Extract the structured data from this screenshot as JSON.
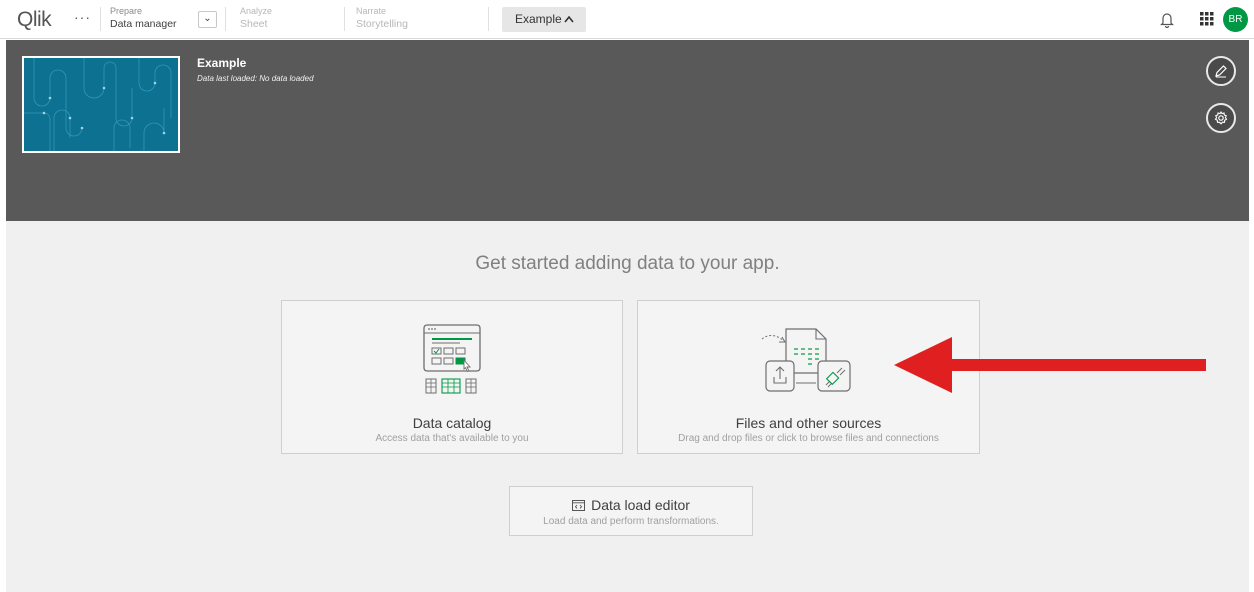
{
  "brand": {
    "logo": "Qlik",
    "more": "···"
  },
  "nav": {
    "prepare": {
      "label": "Prepare",
      "value": "Data manager"
    },
    "analyze": {
      "label": "Analyze",
      "value": "Sheet"
    },
    "narrate": {
      "label": "Narrate",
      "value": "Storytelling"
    },
    "app_tab": "Example"
  },
  "user": {
    "initials": "BR"
  },
  "app": {
    "title": "Example",
    "subtitle": "Data last loaded: No data loaded"
  },
  "main": {
    "headline": "Get started adding data to your app.",
    "cards": {
      "catalog": {
        "title": "Data catalog",
        "desc": "Access data that's available to you"
      },
      "files": {
        "title": "Files and other sources",
        "desc": "Drag and drop files or click to browse files and connections"
      },
      "editor": {
        "title": "Data load editor",
        "desc": "Load data and perform transformations."
      }
    }
  },
  "icons": [
    "more-icon",
    "chevron-down-icon",
    "chevron-up-icon",
    "bell-icon",
    "apps-grid-icon",
    "edit-icon",
    "gear-icon",
    "data-catalog-icon",
    "files-sources-icon",
    "code-icon",
    "arrow-annotation"
  ],
  "colors": {
    "accent_green": "#009845",
    "header_bg": "#595959",
    "thumb_bg": "#0d7192",
    "annotation_red": "#e02020"
  }
}
